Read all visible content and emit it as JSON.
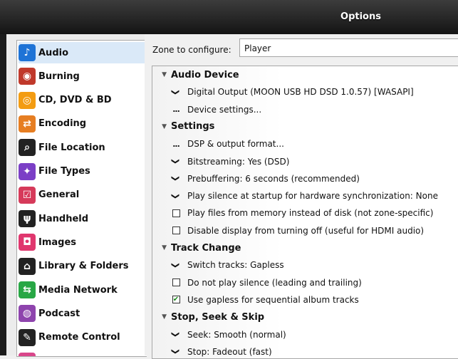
{
  "window": {
    "title": "Options"
  },
  "sidebar": {
    "items": [
      {
        "label": "Audio",
        "icon": "music-note-icon",
        "color": "#1e73d6",
        "glyph": "♪",
        "selected": true
      },
      {
        "label": "Burning",
        "icon": "disc-burn-icon",
        "color": "#c0392b",
        "glyph": "◉"
      },
      {
        "label": "CD, DVD & BD",
        "icon": "cd-icon",
        "color": "#f39c12",
        "glyph": "◎"
      },
      {
        "label": "Encoding",
        "icon": "encoding-arrows-icon",
        "color": "#e67e22",
        "glyph": "⇄"
      },
      {
        "label": "File Location",
        "icon": "file-search-icon",
        "color": "#222222",
        "glyph": "⌕"
      },
      {
        "label": "File Types",
        "icon": "puzzle-icon",
        "color": "#7b3fc6",
        "glyph": "✦"
      },
      {
        "label": "General",
        "icon": "checkbox-icon",
        "color": "#d63a5a",
        "glyph": "☑"
      },
      {
        "label": "Handheld",
        "icon": "usb-icon",
        "color": "#222222",
        "glyph": "ψ"
      },
      {
        "label": "Images",
        "icon": "camera-icon",
        "color": "#e0376e",
        "glyph": "◘"
      },
      {
        "label": "Library & Folders",
        "icon": "house-icon",
        "color": "#222222",
        "glyph": "⌂"
      },
      {
        "label": "Media Network",
        "icon": "network-icon",
        "color": "#28a745",
        "glyph": "⇆"
      },
      {
        "label": "Podcast",
        "icon": "podcast-icon",
        "color": "#8e44ad",
        "glyph": "◍"
      },
      {
        "label": "Remote Control",
        "icon": "remote-icon",
        "color": "#222222",
        "glyph": "✎"
      },
      {
        "label": "",
        "icon": "partial-item-icon",
        "color": "#d9468a",
        "glyph": ""
      }
    ]
  },
  "main": {
    "zone_label": "Zone to configure:",
    "zone_value": "Player",
    "tree": [
      {
        "type": "header",
        "label": "Audio Device"
      },
      {
        "type": "chevron",
        "label": "Digital Output (MOON USB HD DSD 1.0.57) [WASAPI]"
      },
      {
        "type": "dots",
        "label": "Device settings..."
      },
      {
        "type": "header",
        "label": "Settings"
      },
      {
        "type": "dots",
        "label": "DSP & output format..."
      },
      {
        "type": "chevron",
        "label": "Bitstreaming: Yes (DSD)"
      },
      {
        "type": "chevron",
        "label": "Prebuffering: 6 seconds (recommended)"
      },
      {
        "type": "chevron",
        "label": "Play silence at startup for hardware synchronization: None"
      },
      {
        "type": "checkbox",
        "checked": false,
        "label": "Play files from memory instead of disk (not zone-specific)"
      },
      {
        "type": "checkbox",
        "checked": false,
        "label": "Disable display from turning off (useful for HDMI audio)"
      },
      {
        "type": "header",
        "label": "Track Change"
      },
      {
        "type": "chevron",
        "label": "Switch tracks: Gapless"
      },
      {
        "type": "checkbox",
        "checked": false,
        "label": "Do not play silence (leading and trailing)"
      },
      {
        "type": "checkbox",
        "checked": true,
        "label": "Use gapless for sequential album tracks"
      },
      {
        "type": "header",
        "label": "Stop, Seek & Skip"
      },
      {
        "type": "chevron",
        "label": "Seek: Smooth (normal)"
      },
      {
        "type": "chevron",
        "label": "Stop: Fadeout (fast)"
      }
    ]
  }
}
